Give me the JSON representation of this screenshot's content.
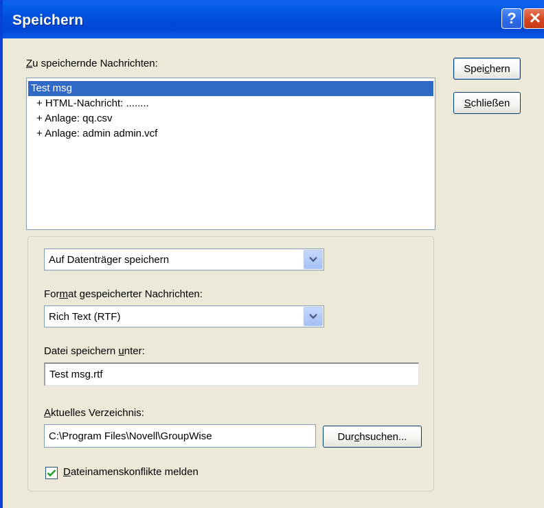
{
  "window": {
    "title": "Speichern",
    "help_label": "?",
    "close_label": "✕"
  },
  "messages": {
    "label_prefix": "",
    "label_mnemonic": "Z",
    "label_rest": "u speichernde Nachrichten:",
    "items": [
      {
        "text": "Test msg",
        "selected": true
      },
      {
        "text": "+ HTML-Nachricht: ........",
        "selected": false
      },
      {
        "text": "+ Anlage: qq.csv",
        "selected": false
      },
      {
        "text": "+ Anlage: admin admin.vcf",
        "selected": false
      }
    ]
  },
  "buttons": {
    "save_pre": "Spei",
    "save_mn": "c",
    "save_post": "hern",
    "close_pre": "",
    "close_mn": "S",
    "close_post": "chließen",
    "browse_pre": "Dur",
    "browse_mn": "c",
    "browse_post": "hsuchen..."
  },
  "destination": {
    "selected": "Auf Datenträger speichern"
  },
  "format": {
    "label_pre": "For",
    "label_mn": "m",
    "label_post": "at gespeicherter Nachrichten:",
    "selected": "Rich Text (RTF)"
  },
  "filename": {
    "label_pre": "Datei speichern ",
    "label_mn": "u",
    "label_post": "nter:",
    "value": "Test msg.rtf"
  },
  "directory": {
    "label_pre": "",
    "label_mn": "A",
    "label_post": "ktuelles Verzeichnis:",
    "value": "C:\\Program Files\\Novell\\GroupWise"
  },
  "conflicts": {
    "label_pre": "",
    "label_mn": "D",
    "label_post": "ateinamenskonflikte melden",
    "checked": true
  },
  "colors": {
    "titlebar": "#0054E3",
    "selection": "#316AC5",
    "dialog_bg": "#ECE9D8"
  }
}
